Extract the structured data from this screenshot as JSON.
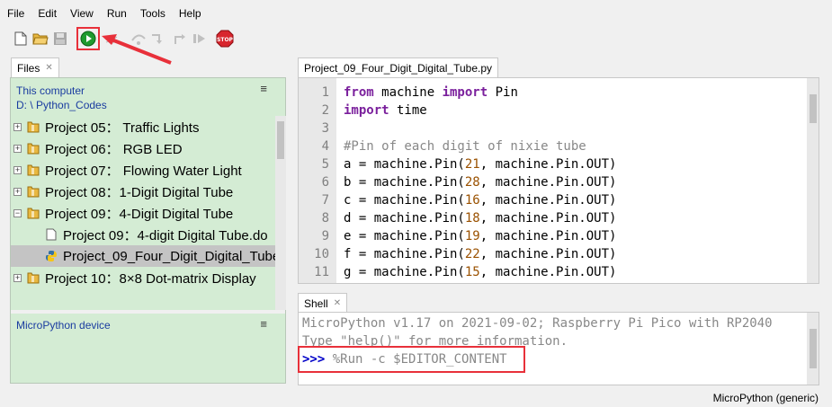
{
  "menu": [
    "File",
    "Edit",
    "View",
    "Run",
    "Tools",
    "Help"
  ],
  "toolbar": {
    "new_icon": "new-file-icon",
    "open_icon": "open-folder-icon",
    "save_icon": "save-icon",
    "run_icon": "run-icon",
    "debug_icon": "debug-icon",
    "step_over_icon": "step-over-icon",
    "step_into_icon": "step-into-icon",
    "step_out_icon": "step-out-icon",
    "resume_icon": "resume-icon",
    "stop_icon": "stop-icon",
    "stop_label": "STOP"
  },
  "files_tab": {
    "label": "Files"
  },
  "files": {
    "computer_label": "This computer",
    "path": "D: \\ Python_Codes",
    "items": [
      {
        "label": "Project 05： Traffic Lights",
        "type": "folder",
        "expander": "+"
      },
      {
        "label": "Project 06： RGB LED",
        "type": "folder",
        "expander": "+"
      },
      {
        "label": "Project 07： Flowing Water Light",
        "type": "folder",
        "expander": "+"
      },
      {
        "label": "Project 08：1-Digit Digital Tube",
        "type": "folder",
        "expander": "+"
      },
      {
        "label": "Project 09：4-Digit Digital Tube",
        "type": "folder",
        "expander": "−"
      },
      {
        "label": "Project 09：4-digit Digital Tube.do",
        "type": "file"
      },
      {
        "label": "Project_09_Four_Digit_Digital_Tube",
        "type": "python"
      },
      {
        "label": "Project 10：8×8 Dot-matrix Display",
        "type": "folder",
        "expander": "+"
      }
    ],
    "device_label": "MicroPython device"
  },
  "editor_tab": {
    "label": "Project_09_Four_Digit_Digital_Tube.py"
  },
  "editor": {
    "line_numbers": [
      "1",
      "2",
      "3",
      "4",
      "5",
      "6",
      "7",
      "8",
      "9",
      "10",
      "11"
    ],
    "lines": [
      [
        {
          "t": "from",
          "c": "kw"
        },
        {
          "t": " machine ",
          "c": ""
        },
        {
          "t": "import",
          "c": "kw"
        },
        {
          "t": " Pin",
          "c": ""
        }
      ],
      [
        {
          "t": "import",
          "c": "kw"
        },
        {
          "t": " time",
          "c": ""
        }
      ],
      [],
      [
        {
          "t": "#Pin of each digit of nixie tube",
          "c": "com"
        }
      ],
      [
        {
          "t": "a = machine.Pin(",
          "c": ""
        },
        {
          "t": "21",
          "c": "num"
        },
        {
          "t": ", machine.Pin.OUT)",
          "c": ""
        }
      ],
      [
        {
          "t": "b = machine.Pin(",
          "c": ""
        },
        {
          "t": "28",
          "c": "num"
        },
        {
          "t": ", machine.Pin.OUT)",
          "c": ""
        }
      ],
      [
        {
          "t": "c = machine.Pin(",
          "c": ""
        },
        {
          "t": "16",
          "c": "num"
        },
        {
          "t": ", machine.Pin.OUT)",
          "c": ""
        }
      ],
      [
        {
          "t": "d = machine.Pin(",
          "c": ""
        },
        {
          "t": "18",
          "c": "num"
        },
        {
          "t": ", machine.Pin.OUT)",
          "c": ""
        }
      ],
      [
        {
          "t": "e = machine.Pin(",
          "c": ""
        },
        {
          "t": "19",
          "c": "num"
        },
        {
          "t": ", machine.Pin.OUT)",
          "c": ""
        }
      ],
      [
        {
          "t": "f = machine.Pin(",
          "c": ""
        },
        {
          "t": "22",
          "c": "num"
        },
        {
          "t": ", machine.Pin.OUT)",
          "c": ""
        }
      ],
      [
        {
          "t": "g = machine.Pin(",
          "c": ""
        },
        {
          "t": "15",
          "c": "num"
        },
        {
          "t": ", machine.Pin.OUT)",
          "c": ""
        }
      ]
    ]
  },
  "shell_tab": {
    "label": "Shell"
  },
  "shell": {
    "line1": "MicroPython v1.17 on 2021-09-02; Raspberry Pi Pico with RP2040",
    "line2": "Type \"help()\" for more information.",
    "prompt": ">>>",
    "command": " %Run -c $EDITOR_CONTENT"
  },
  "status": {
    "interpreter": "MicroPython (generic)"
  },
  "colors": {
    "highlight": "#e8303a",
    "files_bg": "#d4ecd4"
  }
}
